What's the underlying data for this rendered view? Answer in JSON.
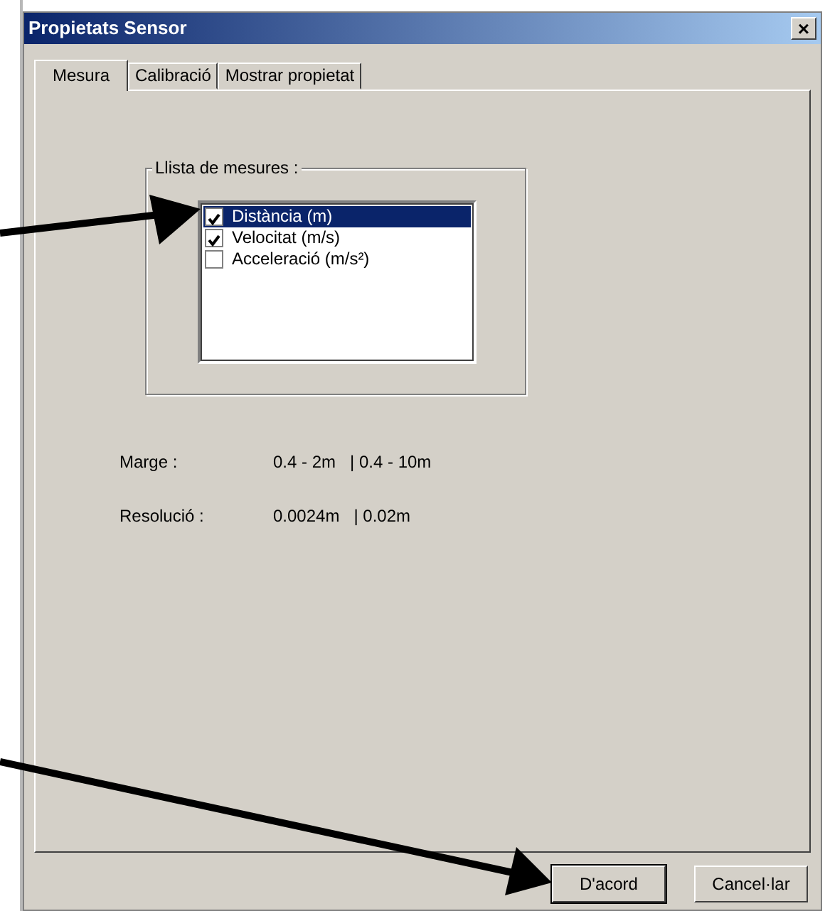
{
  "window": {
    "title": "Propietats Sensor",
    "close": "×"
  },
  "tabs": [
    {
      "label": "Mesura",
      "selected": true
    },
    {
      "label": "Calibració",
      "selected": false
    },
    {
      "label": "Mostrar propietat",
      "selected": false
    }
  ],
  "measures_group": {
    "legend": "Llista de mesures :",
    "items": [
      {
        "label": "Distància (m)",
        "checked": true,
        "selected": true
      },
      {
        "label": "Velocitat (m/s)",
        "checked": true,
        "selected": false
      },
      {
        "label": "Acceleració (m/s²)",
        "checked": false,
        "selected": false
      }
    ]
  },
  "info": [
    {
      "label": "Marge :",
      "value": "0.4 - 2m   | 0.4 - 10m"
    },
    {
      "label": "Resolució :",
      "value": "0.0024m   | 0.02m"
    }
  ],
  "buttons": [
    {
      "label": "D'acord",
      "default": true
    },
    {
      "label": "Cancel·lar",
      "default": false
    }
  ]
}
